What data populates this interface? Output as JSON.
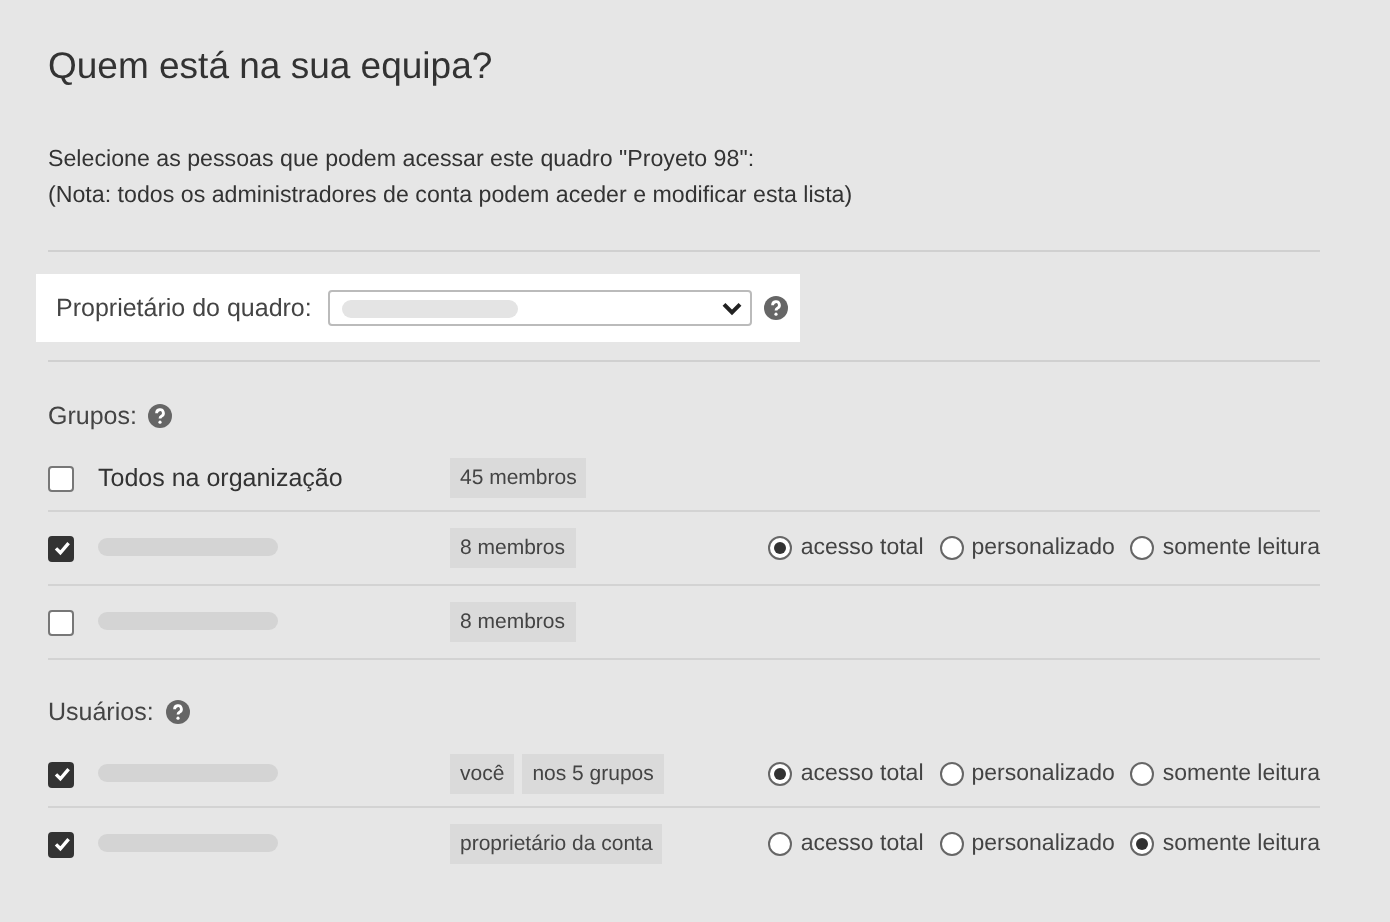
{
  "title": "Quem está na sua equipa?",
  "description": [
    "Selecione as pessoas que podem acessar este quadro \"Proyeto 98\":",
    "(Nota: todos os administradores de conta podem aceder e modificar esta lista)"
  ],
  "owner": {
    "label": "Proprietário do quadro:"
  },
  "sections": [
    {
      "heading": "Grupos:",
      "rows": [
        {
          "checked": false,
          "name": "Todos na organização",
          "tags": [
            "45 membros"
          ]
        },
        {
          "checked": true,
          "tags": [
            "8 membros"
          ],
          "access": [
            {
              "label": "acesso total",
              "selected": true
            },
            {
              "label": "personalizado",
              "selected": false
            },
            {
              "label": "somente leitura",
              "selected": false
            }
          ]
        },
        {
          "checked": false,
          "tags": [
            "8 membros"
          ]
        }
      ]
    },
    {
      "heading": "Usuários:",
      "rows": [
        {
          "checked": true,
          "tags": [
            "você",
            "nos 5 grupos"
          ],
          "access": [
            {
              "label": "acesso total",
              "selected": true
            },
            {
              "label": "personalizado",
              "selected": false
            },
            {
              "label": "somente leitura",
              "selected": false
            }
          ]
        },
        {
          "checked": true,
          "tags": [
            "proprietário da conta"
          ],
          "access": [
            {
              "label": "acesso total",
              "selected": false
            },
            {
              "label": "personalizado",
              "selected": false
            },
            {
              "label": "somente leitura",
              "selected": true
            }
          ]
        }
      ]
    }
  ]
}
